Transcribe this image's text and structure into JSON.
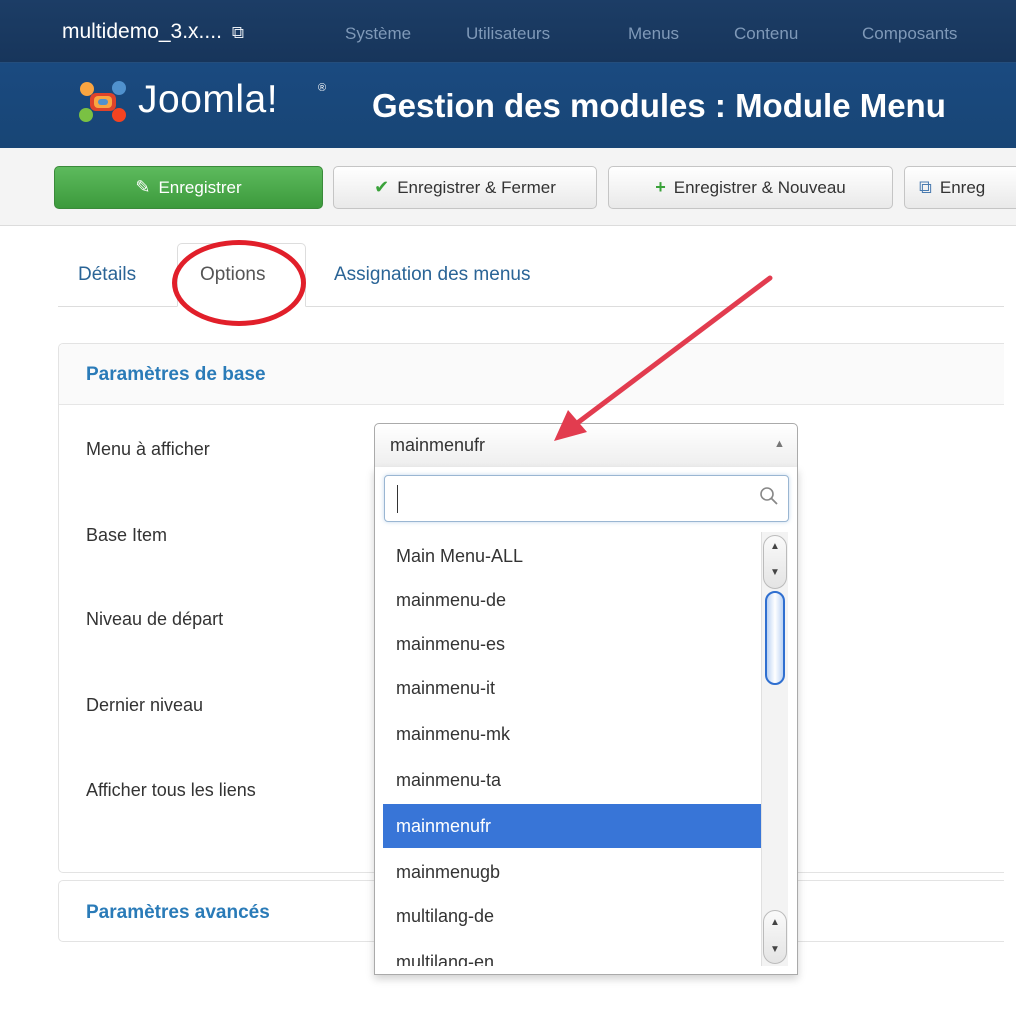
{
  "topbar": {
    "site_name": "multidemo_3.x....",
    "external_icon": "external-link-icon",
    "nav": [
      "Système",
      "Utilisateurs",
      "Menus",
      "Contenu",
      "Composants"
    ]
  },
  "header": {
    "logo_text": "Joomla!",
    "logo_reg": "®",
    "title": "Gestion des modules : Module Menu"
  },
  "toolbar": {
    "save_label": "Enregistrer",
    "save_close_label": "Enregistrer & Fermer",
    "save_new_label": "Enregistrer & Nouveau",
    "save_copy_label": "Enreg",
    "save_icon": "edit-icon",
    "save_close_icon": "check-icon",
    "save_new_icon": "plus-icon",
    "save_copy_icon": "copy-icon"
  },
  "tabs": {
    "details": "Détails",
    "options": "Options",
    "assignment": "Assignation des menus"
  },
  "basic_panel": {
    "title": "Paramètres de base",
    "fields": {
      "menu": "Menu à afficher",
      "base_item": "Base Item",
      "start_level": "Niveau de départ",
      "end_level": "Dernier niveau",
      "show_sub": "Afficher tous les liens"
    }
  },
  "advanced_panel": {
    "title": "Paramètres avancés"
  },
  "menu_select": {
    "value": "mainmenufr",
    "search_value": "",
    "options": [
      "Main Menu-ALL",
      "mainmenu-de",
      "mainmenu-es",
      "mainmenu-it",
      "mainmenu-mk",
      "mainmenu-ta",
      "mainmenufr",
      "mainmenugb",
      "multilang-de",
      "multilang-en"
    ],
    "selected_index": 6
  },
  "colors": {
    "topbar": "#1c3d66",
    "header": "#1a4a80",
    "save_green": "#46a546",
    "link_blue": "#2a6496",
    "panel_title": "#2a7bb8",
    "option_highlight": "#3875d7",
    "annotation_red": "#e11f2a",
    "annotation_arrow": "#e23c4f"
  }
}
